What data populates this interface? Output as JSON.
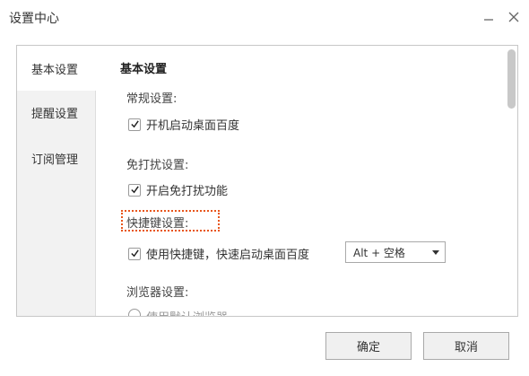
{
  "window": {
    "title": "设置中心",
    "minimize_icon": "minimize-icon",
    "close_icon": "close-icon"
  },
  "sidebar": {
    "items": [
      {
        "label": "基本设置",
        "active": true
      },
      {
        "label": "提醒设置",
        "active": false
      },
      {
        "label": "订阅管理",
        "active": false
      }
    ]
  },
  "content": {
    "section_title": "基本设置",
    "general": {
      "label": "常规设置:",
      "autostart": {
        "label": "开机启动桌面百度",
        "checked": true
      }
    },
    "dnd": {
      "label": "免打扰设置:",
      "enable": {
        "label": "开启免打扰功能",
        "checked": true
      }
    },
    "hotkey": {
      "label": "快捷键设置:",
      "use_hotkey": {
        "label": "使用快捷键，快速启动桌面百度",
        "checked": true
      },
      "selected": "Alt + 空格"
    },
    "browser": {
      "label": "浏览器设置:",
      "option_partial": "使用默认浏览器"
    }
  },
  "footer": {
    "ok_label": "确定",
    "cancel_label": "取消"
  },
  "colors": {
    "highlight": "#e8551b",
    "sidebar_bg": "#f2f2f2"
  }
}
